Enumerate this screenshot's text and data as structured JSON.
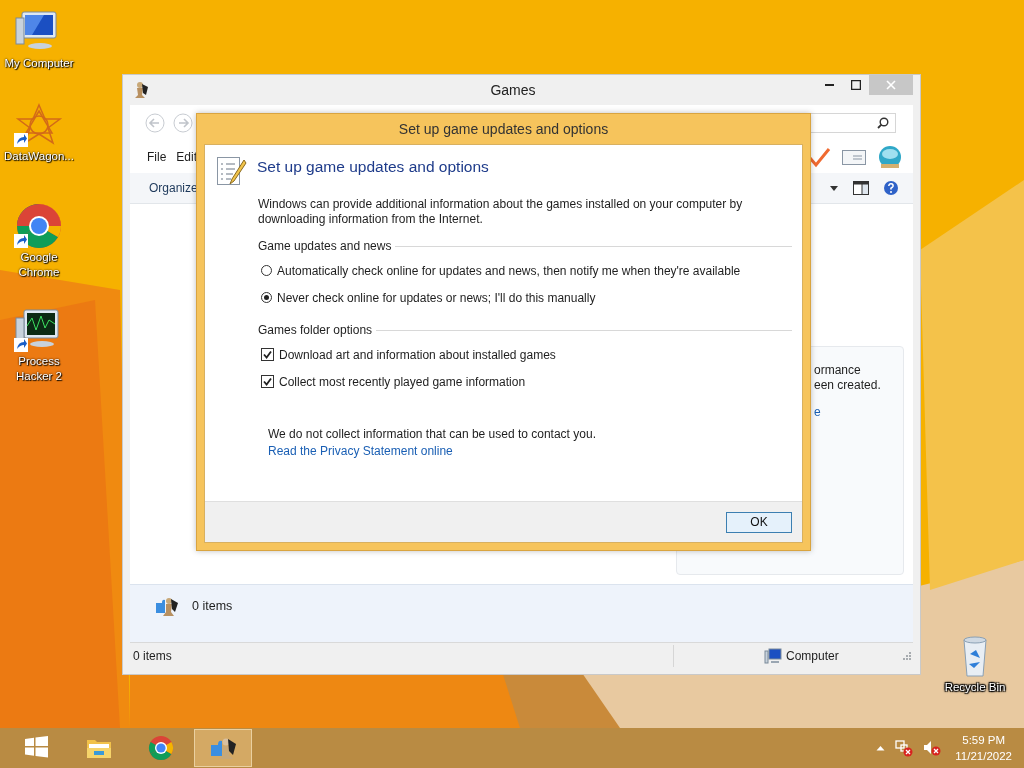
{
  "desktop": {
    "icons": [
      {
        "label": "My Computer",
        "kind": "computer",
        "shortcut": false
      },
      {
        "label": "DataWagon...",
        "kind": "emblem",
        "shortcut": true
      },
      {
        "label": "Google Chrome",
        "kind": "browser",
        "shortcut": true
      },
      {
        "label": "Process Hacker 2",
        "kind": "monitor",
        "shortcut": true
      }
    ],
    "recycle_bin": {
      "label": "Recycle Bin"
    }
  },
  "explorer_window": {
    "title": "Games",
    "menu": [
      "File",
      "Edit"
    ],
    "toolbar": [
      "Organize"
    ],
    "panel": {
      "lines": [
        "ormance",
        "een created."
      ],
      "link": "e"
    },
    "details": {
      "text": "0 items"
    },
    "status_bar": {
      "items": "0 items",
      "location": "Computer"
    }
  },
  "dialog": {
    "title": "Set up game updates and options",
    "heading": "Set up game updates and options",
    "intro": "Windows can provide additional information about the games installed on your computer by downloading information from the Internet.",
    "groups": [
      {
        "label": "Game updates and news",
        "options": [
          {
            "kind": "radio",
            "label": "Automatically check online for updates and news, then notify me when they're available",
            "selected": false
          },
          {
            "kind": "radio",
            "label": "Never check online for updates or news; I'll do this manually",
            "selected": true
          }
        ]
      },
      {
        "label": "Games folder options",
        "options": [
          {
            "kind": "checkbox",
            "label": "Download art and information about installed games",
            "checked": true
          },
          {
            "kind": "checkbox",
            "label": "Collect most recently played game information",
            "checked": true
          }
        ]
      }
    ],
    "note": "We do not collect information that can be used to contact you.",
    "link": "Read the Privacy Statement online",
    "buttons": [
      "OK"
    ]
  },
  "taskbar": {
    "items": [
      {
        "kind": "start",
        "active": false
      },
      {
        "kind": "explorer",
        "active": false
      },
      {
        "kind": "chrome",
        "active": false
      },
      {
        "kind": "games",
        "active": true
      }
    ],
    "clock": {
      "time": "5:59 PM",
      "date": "11/21/2022"
    }
  }
}
